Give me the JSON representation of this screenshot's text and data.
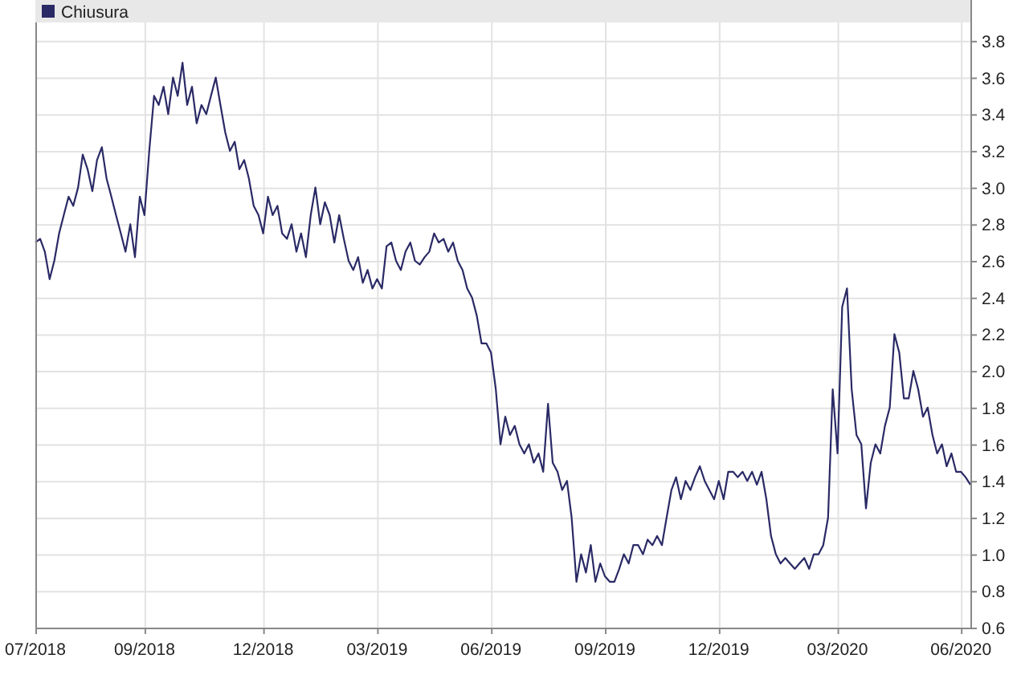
{
  "chart_data": {
    "type": "line",
    "grid": true,
    "categories": [
      "07/2018",
      null,
      null,
      null,
      null,
      null,
      null,
      null,
      null,
      null,
      null,
      null,
      null,
      null,
      null,
      null,
      null,
      null,
      null,
      null,
      null,
      null,
      null,
      "09/2018",
      null,
      null,
      null,
      null,
      null,
      null,
      null,
      null,
      null,
      null,
      null,
      null,
      null,
      null,
      null,
      null,
      null,
      null,
      null,
      null,
      null,
      null,
      null,
      null,
      "12/2018",
      null,
      null,
      null,
      null,
      null,
      null,
      null,
      null,
      null,
      null,
      null,
      null,
      null,
      null,
      null,
      null,
      null,
      null,
      null,
      null,
      null,
      null,
      null,
      "03/2019",
      null,
      null,
      null,
      null,
      null,
      null,
      null,
      null,
      null,
      null,
      null,
      null,
      null,
      null,
      null,
      null,
      null,
      null,
      null,
      null,
      null,
      null,
      null,
      "06/2019",
      null,
      null,
      null,
      null,
      null,
      null,
      null,
      null,
      null,
      null,
      null,
      null,
      null,
      null,
      null,
      null,
      null,
      null,
      null,
      null,
      null,
      null,
      null,
      "09/2019",
      null,
      null,
      null,
      null,
      null,
      null,
      null,
      null,
      null,
      null,
      null,
      null,
      null,
      null,
      null,
      null,
      null,
      null,
      null,
      null,
      null,
      null,
      null,
      "12/2019",
      null,
      null,
      null,
      null,
      null,
      null,
      null,
      null,
      null,
      null,
      null,
      null,
      null,
      null,
      null,
      null,
      null,
      null,
      null,
      null,
      null,
      null,
      null,
      null,
      "03/2020",
      null,
      null,
      null,
      null,
      null,
      null,
      null,
      null,
      null,
      null,
      null,
      null,
      null,
      null,
      null,
      null,
      null,
      null,
      null,
      null,
      null,
      null,
      null,
      null,
      null,
      "06/2020",
      null,
      null
    ],
    "series": [
      {
        "name": "Chiusura",
        "color": "#2a2a66",
        "values": [
          2.7,
          2.72,
          2.65,
          2.5,
          2.6,
          2.75,
          2.85,
          2.95,
          2.9,
          3.0,
          3.18,
          3.1,
          2.98,
          3.15,
          3.22,
          3.05,
          2.95,
          2.85,
          2.75,
          2.65,
          2.8,
          2.62,
          2.95,
          2.85,
          3.2,
          3.5,
          3.45,
          3.55,
          3.4,
          3.6,
          3.5,
          3.68,
          3.45,
          3.55,
          3.35,
          3.45,
          3.4,
          3.5,
          3.6,
          3.45,
          3.3,
          3.2,
          3.25,
          3.1,
          3.15,
          3.05,
          2.9,
          2.85,
          2.75,
          2.95,
          2.85,
          2.9,
          2.75,
          2.72,
          2.8,
          2.65,
          2.75,
          2.62,
          2.85,
          3.0,
          2.8,
          2.92,
          2.85,
          2.7,
          2.85,
          2.72,
          2.6,
          2.55,
          2.62,
          2.48,
          2.55,
          2.45,
          2.5,
          2.45,
          2.68,
          2.7,
          2.6,
          2.55,
          2.65,
          2.7,
          2.6,
          2.58,
          2.62,
          2.65,
          2.75,
          2.7,
          2.72,
          2.65,
          2.7,
          2.6,
          2.55,
          2.45,
          2.4,
          2.3,
          2.15,
          2.15,
          2.1,
          1.9,
          1.6,
          1.75,
          1.65,
          1.7,
          1.6,
          1.55,
          1.6,
          1.5,
          1.55,
          1.45,
          1.82,
          1.5,
          1.45,
          1.35,
          1.4,
          1.2,
          0.85,
          1.0,
          0.9,
          1.05,
          0.85,
          0.95,
          0.88,
          0.85,
          0.85,
          0.92,
          1.0,
          0.95,
          1.05,
          1.05,
          1.0,
          1.08,
          1.05,
          1.1,
          1.05,
          1.2,
          1.35,
          1.42,
          1.3,
          1.4,
          1.35,
          1.42,
          1.48,
          1.4,
          1.35,
          1.3,
          1.4,
          1.3,
          1.45,
          1.45,
          1.42,
          1.45,
          1.4,
          1.45,
          1.38,
          1.45,
          1.3,
          1.1,
          1.0,
          0.95,
          0.98,
          0.95,
          0.92,
          0.95,
          0.98,
          0.92,
          1.0,
          1.0,
          1.05,
          1.2,
          1.9,
          1.55,
          2.35,
          2.45,
          1.9,
          1.65,
          1.6,
          1.25,
          1.5,
          1.6,
          1.55,
          1.7,
          1.8,
          2.2,
          2.1,
          1.85,
          1.85,
          2.0,
          1.9,
          1.75,
          1.8,
          1.65,
          1.55,
          1.6,
          1.48,
          1.55,
          1.45,
          1.45,
          1.42,
          1.38
        ]
      }
    ],
    "ylim": [
      0.6,
      3.9
    ],
    "yticks": [
      {
        "value": 0.6,
        "label": "0.6"
      },
      {
        "value": 0.8,
        "label": "0.8"
      },
      {
        "value": 1.0,
        "label": "1.0"
      },
      {
        "value": 1.2,
        "label": "1.2"
      },
      {
        "value": 1.4,
        "label": "1.4"
      },
      {
        "value": 1.6,
        "label": "1.6"
      },
      {
        "value": 1.8,
        "label": "1.8"
      },
      {
        "value": 2.0,
        "label": "2.0"
      },
      {
        "value": 2.2,
        "label": "2.2"
      },
      {
        "value": 2.4,
        "label": "2.4"
      },
      {
        "value": 2.6,
        "label": "2.6"
      },
      {
        "value": 2.8,
        "label": "2.8"
      },
      {
        "value": 3.0,
        "label": "3.0"
      },
      {
        "value": 3.2,
        "label": "3.2"
      },
      {
        "value": 3.4,
        "label": "3.4"
      },
      {
        "value": 3.6,
        "label": "3.6"
      },
      {
        "value": 3.8,
        "label": "3.8"
      }
    ]
  }
}
